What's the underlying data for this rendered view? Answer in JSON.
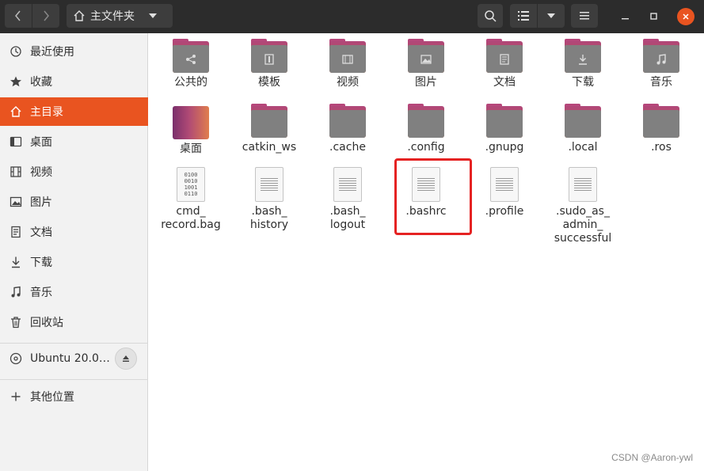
{
  "header": {
    "path_label": "主文件夹",
    "icons": {
      "back": "chevron-left-icon",
      "forward": "chevron-right-icon",
      "home": "home-icon",
      "search": "search-icon",
      "list_view": "list-icon",
      "menu": "hamburger-icon",
      "minimize": "minimize-icon",
      "maximize": "maximize-icon",
      "close": "close-icon"
    }
  },
  "sidebar": {
    "items": [
      {
        "label": "最近使用",
        "icon": "clock-icon"
      },
      {
        "label": "收藏",
        "icon": "star-icon"
      },
      {
        "label": "主目录",
        "icon": "home-icon",
        "active": true
      },
      {
        "label": "桌面",
        "icon": "desktop-icon"
      },
      {
        "label": "视频",
        "icon": "video-icon"
      },
      {
        "label": "图片",
        "icon": "picture-icon"
      },
      {
        "label": "文档",
        "icon": "document-icon"
      },
      {
        "label": "下载",
        "icon": "download-icon"
      },
      {
        "label": "音乐",
        "icon": "music-icon"
      },
      {
        "label": "回收站",
        "icon": "trash-icon"
      }
    ],
    "device": {
      "label": "Ubuntu 20.0…",
      "icon": "disc-icon",
      "eject_icon": "eject-icon"
    },
    "other": {
      "label": "其他位置",
      "icon": "plus-icon"
    }
  },
  "files": [
    {
      "name": "公共的",
      "kind": "folder",
      "emblem": "share-icon"
    },
    {
      "name": "模板",
      "kind": "folder",
      "emblem": "template-icon"
    },
    {
      "name": "视频",
      "kind": "folder",
      "emblem": "video-icon"
    },
    {
      "name": "图片",
      "kind": "folder",
      "emblem": "picture-icon"
    },
    {
      "name": "文档",
      "kind": "folder",
      "emblem": "document-icon"
    },
    {
      "name": "下载",
      "kind": "folder",
      "emblem": "download-icon"
    },
    {
      "name": "音乐",
      "kind": "folder",
      "emblem": "music-icon"
    },
    {
      "name": "桌面",
      "kind": "desktop"
    },
    {
      "name": "catkin_ws",
      "kind": "folder"
    },
    {
      "name": ".cache",
      "kind": "folder"
    },
    {
      "name": ".config",
      "kind": "folder"
    },
    {
      "name": ".gnupg",
      "kind": "folder"
    },
    {
      "name": ".local",
      "kind": "folder"
    },
    {
      "name": ".ros",
      "kind": "folder"
    },
    {
      "name": "cmd_\nrecord.bag",
      "kind": "binary",
      "binary_text": "0100\n0010\n1001\n0110"
    },
    {
      "name": ".bash_\nhistory",
      "kind": "text"
    },
    {
      "name": ".bash_\nlogout",
      "kind": "text"
    },
    {
      "name": ".bashrc",
      "kind": "text",
      "highlighted": true
    },
    {
      "name": ".profile",
      "kind": "text"
    },
    {
      "name": ".sudo_as_\nadmin_\nsuccessful",
      "kind": "text"
    }
  ],
  "colors": {
    "accent": "#e95420",
    "highlight": "#e52222",
    "titlebar": "#2c2c2c"
  },
  "watermark": "CSDN @Aaron-ywl"
}
